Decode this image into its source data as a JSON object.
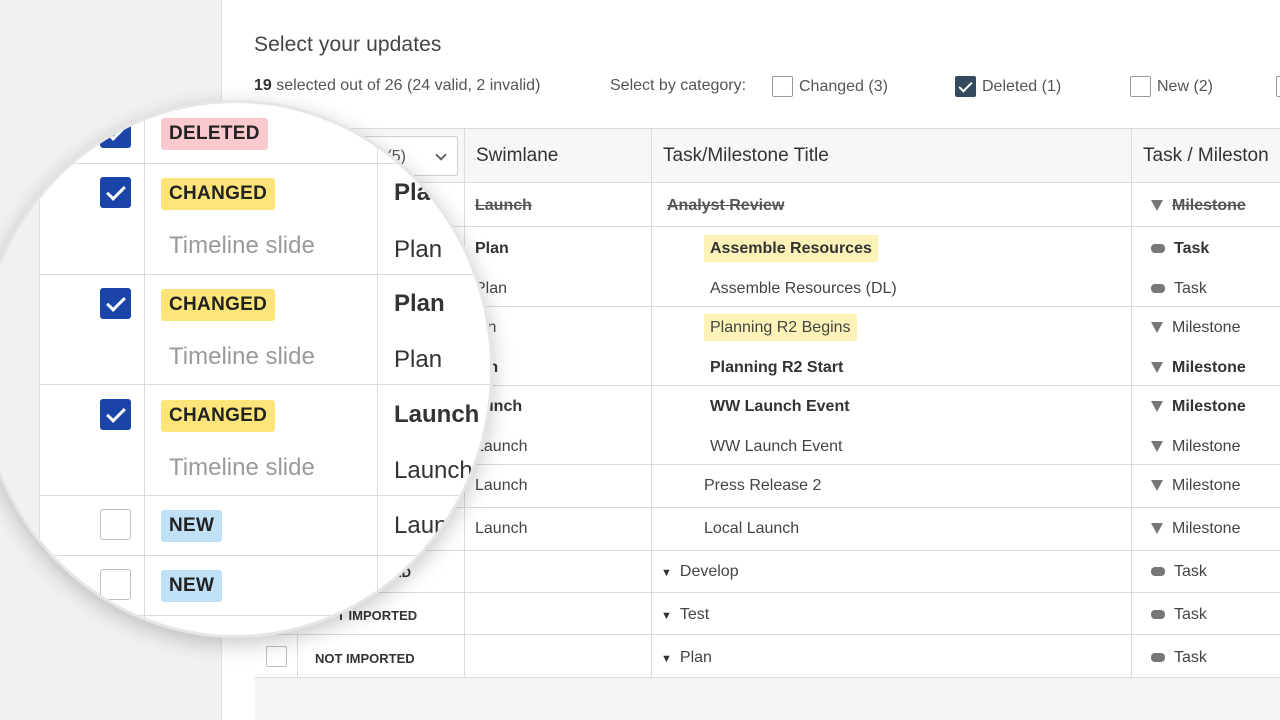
{
  "header": {
    "title": "Select your updates",
    "selected_count": "19",
    "selected_rest": " selected out of 26 (24 valid, 2 invalid)",
    "category_label": "Select by category:",
    "categories": [
      {
        "label": "Changed (3)",
        "checked": false
      },
      {
        "label": "Deleted (1)",
        "checked": true
      },
      {
        "label": "New (2)",
        "checked": false
      }
    ]
  },
  "table": {
    "columns": [
      "Swimlane",
      "Task/Milestone Title",
      "Task / Mileston"
    ],
    "status_filter": "s (5)",
    "rows": [
      {
        "swimlane": "Launch",
        "title": "Analyst Review",
        "type": "Milestone"
      },
      {
        "swimlane": "Plan",
        "title": "Assemble Resources",
        "type": "Task"
      },
      {
        "swimlane": "Plan",
        "title": "Assemble Resources (DL)",
        "type": "Task"
      },
      {
        "swimlane": "lan",
        "title": "Planning R2 Begins",
        "type": "Milestone"
      },
      {
        "swimlane": "lan",
        "title": "Planning R2 Start",
        "type": "Milestone"
      },
      {
        "swimlane": "aunch",
        "title": "WW Launch Event",
        "type": "Milestone"
      },
      {
        "swimlane": "Launch",
        "title": "WW Launch Event",
        "type": "Milestone"
      },
      {
        "swimlane": "Launch",
        "title": "Press Release 2",
        "type": "Milestone"
      },
      {
        "swimlane": "Launch",
        "title": "Local Launch",
        "type": "Milestone"
      },
      {
        "status": "ED",
        "title": "Develop",
        "type": "Task"
      },
      {
        "status": "T IMPORTED",
        "title": "Test",
        "type": "Task"
      },
      {
        "status": "NOT IMPORTED",
        "title": "Plan",
        "type": "Task"
      }
    ]
  },
  "magnifier": {
    "rows": [
      {
        "badge": "DELETED",
        "checked": true
      },
      {
        "badge": "CHANGED",
        "sub": "Timeline slide",
        "lane1": "Pla",
        "lane2": "Plan",
        "checked": true
      },
      {
        "badge": "CHANGED",
        "sub": "Timeline slide",
        "lane1": "Plan",
        "lane2": "Plan",
        "checked": true
      },
      {
        "badge": "CHANGED",
        "sub": "Timeline slide",
        "lane1": "Launch",
        "lane2": "Launch",
        "checked": true
      },
      {
        "badge": "NEW",
        "lane1": "Laun",
        "checked": false
      },
      {
        "badge": "NEW",
        "checked": false
      }
    ]
  },
  "colors": {
    "deleted_badge": "#f9c9cf",
    "changed_badge": "#fde57a",
    "new_badge": "#bfe0f6",
    "highlight": "#fdf3b8",
    "checkbox_checked": "#1a44a8"
  }
}
